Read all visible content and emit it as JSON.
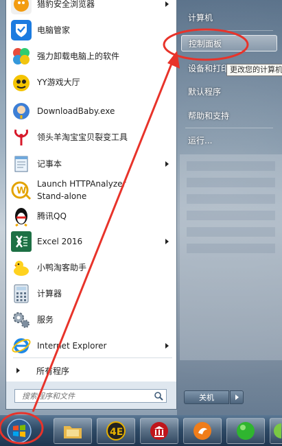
{
  "programs": [
    {
      "label": "猎豹安全浏览器",
      "icon": "cheetah-browser-icon",
      "has_submenu": true
    },
    {
      "label": "电脑管家",
      "icon": "tencent-pc-manager-icon",
      "has_submenu": false
    },
    {
      "label": "强力卸载电脑上的软件",
      "icon": "uninstaller-icon",
      "has_submenu": false
    },
    {
      "label": "YY游戏大厅",
      "icon": "yy-game-icon",
      "has_submenu": false
    },
    {
      "label": "DownloadBaby.exe",
      "icon": "download-baby-icon",
      "has_submenu": false
    },
    {
      "label": "领头羊淘宝宝贝裂变工具",
      "icon": "ram-tool-icon",
      "has_submenu": false
    },
    {
      "label": "记事本",
      "icon": "notepad-icon",
      "has_submenu": true
    },
    {
      "label": "Launch HTTPAnalyzer",
      "label2": "Stand-alone",
      "icon": "httpanalyzer-icon",
      "has_submenu": false
    },
    {
      "label": "腾讯QQ",
      "icon": "qq-penguin-icon",
      "has_submenu": false
    },
    {
      "label": "Excel 2016",
      "icon": "excel-icon",
      "has_submenu": true
    },
    {
      "label": "小鸭淘客助手",
      "icon": "duck-icon",
      "has_submenu": false
    },
    {
      "label": "计算器",
      "icon": "calculator-icon",
      "has_submenu": false
    },
    {
      "label": "服务",
      "icon": "services-gear-icon",
      "has_submenu": false
    },
    {
      "label": "Internet Explorer",
      "icon": "internet-explorer-icon",
      "has_submenu": true
    }
  ],
  "all_programs": "所有程序",
  "search": {
    "placeholder": "搜索程序和文件"
  },
  "right_panel": {
    "computer": "计算机",
    "control_panel": "控制面板",
    "devices": "设备和打印",
    "default_programs": "默认程序",
    "help": "帮助和支持",
    "run": "运行..."
  },
  "tooltip": "更改您的计算机",
  "shutdown": "关机",
  "taskbar": {
    "items": [
      "file-explorer-icon",
      "4e-app-icon",
      "red-building-icon",
      "orange-cheetah-icon",
      "green-ball-icon",
      "partial-app-icon"
    ]
  },
  "colors": {
    "annotation": "#e8332a",
    "highlight": "#ffffff",
    "taskbar": "#2e4a66"
  }
}
